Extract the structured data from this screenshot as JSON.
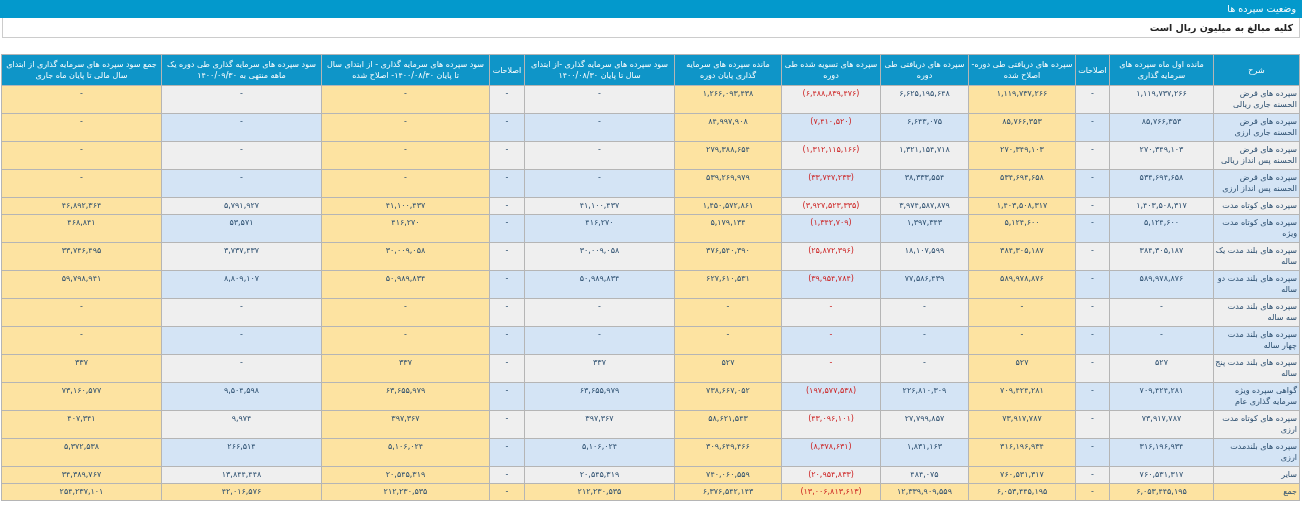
{
  "header": {
    "title": "وضعیت سپرده ها"
  },
  "note": "کلیه مبالغ به میلیون ریال است",
  "table": {
    "columns": [
      {
        "label": "شرح",
        "highlight": false,
        "negative": false
      },
      {
        "label": "مانده اول ماه سپرده های سرمایه گذاری",
        "highlight": false,
        "negative": false
      },
      {
        "label": "اصلاحات",
        "highlight": false,
        "negative": false
      },
      {
        "label": "سپرده های دریافتی طی دوره- اصلاح شده",
        "highlight": true,
        "negative": false
      },
      {
        "label": "سپرده های دریافتی طی دوره",
        "highlight": false,
        "negative": false
      },
      {
        "label": "سپرده های تسویه شده طی دوره",
        "highlight": false,
        "negative": true
      },
      {
        "label": "مانده سپرده های سرمایه گذاری پایان دوره",
        "highlight": true,
        "negative": false
      },
      {
        "label": "سود سپرده های سرمایه گذاری -از ابتدای سال تا پایان ۱۴۰۰/۰۸/۳۰",
        "highlight": false,
        "negative": false
      },
      {
        "label": "اصلاحات",
        "highlight": false,
        "negative": false
      },
      {
        "label": "سود سپرده های سرمایه گذاری - از ابتدای سال تا پایان ۱۴۰۰/۰۸/۳۰- اصلاح شده",
        "highlight": true,
        "negative": false
      },
      {
        "label": "سود سپرده های سرمایه گذاری طی دوره یک ماهه منتهی به ۱۴۰۰/۰۹/۳۰",
        "highlight": false,
        "negative": false
      },
      {
        "label": "جمع سود سپرده های سرمایه گذاری از ابتدای سال مالی تا پایان ماه جاری",
        "highlight": true,
        "negative": false
      }
    ],
    "rows": [
      {
        "kind": "item",
        "cells": [
          "سپرده های قرض الحسنه جاری ریالی",
          "۱,۱۱۹,۷۳۷,۲۶۶",
          "-",
          "۱,۱۱۹,۷۳۷,۲۶۶",
          "۶,۶۲۵,۱۹۵,۶۴۸",
          "(۶,۴۸۸,۸۳۹,۴۷۶)",
          "۱,۲۶۶,۰۹۳,۴۳۸",
          "-",
          "-",
          "-",
          "-",
          "-"
        ]
      },
      {
        "kind": "item",
        "cells": [
          "سپرده های قرض الحسنه جاری ارزی",
          "۸۵,۷۶۶,۳۵۳",
          "-",
          "۸۵,۷۶۶,۳۵۳",
          "۶,۶۴۳,۰۷۵",
          "(۷,۴۱۰,۵۲۰)",
          "۸۴,۹۹۷,۹۰۸",
          "-",
          "-",
          "-",
          "-",
          "-"
        ]
      },
      {
        "kind": "item",
        "cells": [
          "سپرده های قرض الحسنه پس انداز ریالی",
          "۲۷۰,۳۴۹,۱۰۳",
          "-",
          "۲۷۰,۳۴۹,۱۰۳",
          "۱,۳۲۱,۱۵۴,۷۱۸",
          "(۱,۳۱۲,۱۱۵,۱۶۶)",
          "۲۷۹,۳۸۸,۶۵۴",
          "-",
          "-",
          "-",
          "-",
          "-"
        ]
      },
      {
        "kind": "item",
        "cells": [
          "سپرده های قرض الحسنه پس انداز ارزی",
          "۵۳۴,۶۹۴,۶۵۸",
          "-",
          "۵۳۴,۶۹۴,۶۵۸",
          "۳۸,۳۳۳,۵۵۴",
          "(۳۳,۷۴۷,۲۳۳)",
          "۵۳۹,۲۶۹,۹۷۹",
          "-",
          "-",
          "-",
          "-",
          "-"
        ]
      },
      {
        "kind": "item",
        "cells": [
          "سپرده های کوتاه مدت",
          "۱,۴۰۳,۵۰۸,۳۱۷",
          "-",
          "۱,۴۰۳,۵۰۸,۳۱۷",
          "۳,۹۷۴,۵۸۷,۸۷۹",
          "(۳,۹۲۷,۵۲۳,۳۳۵)",
          "۱,۴۵۰,۵۷۲,۸۶۱",
          "۴۱,۱۰۰,۴۳۷",
          "-",
          "۴۱,۱۰۰,۴۳۷",
          "۵,۷۹۱,۹۲۷",
          "۴۶,۸۹۲,۳۶۴"
        ]
      },
      {
        "kind": "item",
        "cells": [
          "سپرده های کوتاه مدت ویژه",
          "۵,۱۲۴,۶۰۰",
          "-",
          "۵,۱۲۴,۶۰۰",
          "۱,۳۹۷,۳۴۳",
          "(۱,۳۴۲,۷۰۹)",
          "۵,۱۷۹,۱۳۴",
          "۴۱۶,۲۷۰",
          "-",
          "۴۱۶,۲۷۰",
          "۵۳,۵۷۱",
          "۴۶۸,۸۴۱"
        ]
      },
      {
        "kind": "item",
        "cells": [
          "سپرده های بلند مدت یک ساله",
          "۳۸۴,۳۰۵,۱۸۷",
          "-",
          "۳۸۴,۳۰۵,۱۸۷",
          "۱۸,۱۰۷,۵۹۹",
          "(۲۵,۸۷۲,۳۹۶)",
          "۳۷۶,۵۴۰,۳۹۰",
          "۳۰,۰۰۹,۰۵۸",
          "-",
          "۳۰,۰۰۹,۰۵۸",
          "۳,۷۳۷,۴۳۷",
          "۳۳,۷۴۶,۴۹۵"
        ]
      },
      {
        "kind": "item",
        "cells": [
          "سپرده های بلند مدت دو ساله",
          "۵۸۹,۹۷۸,۸۷۶",
          "-",
          "۵۸۹,۹۷۸,۸۷۶",
          "۷۷,۵۸۶,۴۳۹",
          "(۳۹,۹۵۴,۷۸۴)",
          "۶۲۷,۶۱۰,۵۳۱",
          "۵۰,۹۸۹,۸۳۴",
          "-",
          "۵۰,۹۸۹,۸۳۴",
          "۸,۸۰۹,۱۰۷",
          "۵۹,۷۹۸,۹۴۱"
        ]
      },
      {
        "kind": "item",
        "cells": [
          "سپرده های بلند مدت سه ساله",
          "-",
          "-",
          "-",
          "-",
          "-",
          "-",
          "-",
          "-",
          "-",
          "-",
          "-"
        ]
      },
      {
        "kind": "item",
        "cells": [
          "سپرده های بلند مدت چهار ساله",
          "-",
          "-",
          "-",
          "-",
          "-",
          "-",
          "-",
          "-",
          "-",
          "-",
          "-"
        ]
      },
      {
        "kind": "item",
        "cells": [
          "سپرده های بلند مدت پنج ساله",
          "۵۲۷",
          "-",
          "۵۲۷",
          "-",
          "-",
          "۵۲۷",
          "۳۳۷",
          "-",
          "۳۳۷",
          "-",
          "۳۳۷"
        ]
      },
      {
        "kind": "item",
        "cells": [
          "گواهی سپرده ویژه سرمایه گذاری عام",
          "۷۰۹,۴۲۴,۲۸۱",
          "-",
          "۷۰۹,۴۲۴,۲۸۱",
          "۲۲۶,۸۱۰,۳۰۹",
          "(۱۹۷,۵۷۷,۵۳۸)",
          "۷۳۸,۶۶۷,۰۵۲",
          "۶۳,۶۵۵,۹۷۹",
          "-",
          "۶۳,۶۵۵,۹۷۹",
          "۹,۵۰۴,۵۹۸",
          "۷۳,۱۶۰,۵۷۷"
        ]
      },
      {
        "kind": "item",
        "cells": [
          "سپرده های کوتاه مدت ارزی",
          "۷۳,۹۱۷,۷۸۷",
          "-",
          "۷۳,۹۱۷,۷۸۷",
          "۲۷,۷۹۹,۸۵۷",
          "(۴۳,۰۹۶,۱۰۱)",
          "۵۸,۶۲۱,۵۴۳",
          "۳۹۷,۳۶۷",
          "-",
          "۳۹۷,۳۶۷",
          "۹,۹۷۴",
          "۴۰۷,۳۴۱"
        ]
      },
      {
        "kind": "item",
        "cells": [
          "سپرده های بلندمدت ارزی",
          "۳۱۶,۱۹۶,۹۳۴",
          "-",
          "۳۱۶,۱۹۶,۹۳۴",
          "۱,۸۳۱,۱۶۳",
          "(۸,۳۷۸,۶۳۱)",
          "۳۰۹,۶۴۹,۴۶۶",
          "۵,۱۰۶,۰۲۴",
          "-",
          "۵,۱۰۶,۰۲۴",
          "۲۶۶,۵۱۴",
          "۵,۳۷۲,۵۳۸"
        ]
      },
      {
        "kind": "item",
        "cells": [
          "سایر",
          "۷۶۰,۵۳۱,۳۱۷",
          "-",
          "۷۶۰,۵۳۱,۳۱۷",
          "۴۸۴,۰۷۵",
          "(۲۰,۹۵۴,۸۳۳)",
          "۷۴۰,۰۶۰,۵۵۹",
          "۲۰,۵۴۵,۳۱۹",
          "-",
          "۲۰,۵۴۵,۳۱۹",
          "۱۳,۸۴۴,۴۴۸",
          "۳۴,۳۸۹,۷۶۷"
        ]
      },
      {
        "kind": "total",
        "cells": [
          "جمع",
          "۶,۰۵۳,۴۴۵,۱۹۵",
          "-",
          "۶,۰۵۳,۴۴۵,۱۹۵",
          "۱۲,۳۳۹,۹۰۹,۵۵۹",
          "(۱۳,۰۰۶,۸۱۳,۶۱۳)",
          "۶,۳۷۶,۵۴۲,۱۴۳",
          "۲۱۲,۲۳۰,۵۳۵",
          "-",
          "۲۱۲,۲۳۰,۵۳۵",
          "۴۲,۰۱۶,۵۷۶",
          "۲۵۴,۲۳۷,۱۰۱"
        ]
      }
    ]
  }
}
